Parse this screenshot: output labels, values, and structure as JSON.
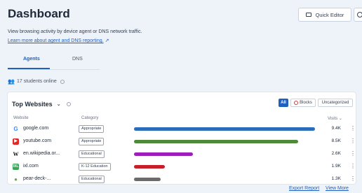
{
  "header": {
    "title": "Dashboard",
    "quick_editor_label": "Quick Editor"
  },
  "intro": {
    "description": "View browsing activity by device agent or DNS network traffic.",
    "learn_more": "Learn more about agent and DNS reporting."
  },
  "tabs": [
    {
      "label": "Agents",
      "active": true
    },
    {
      "label": "DNS",
      "active": false
    }
  ],
  "online_status": "17 students online",
  "card": {
    "scope_label": "Top Websites",
    "filters": [
      "All",
      "Blocks",
      "Uncategorized"
    ],
    "active_filter": "All",
    "columns": {
      "website": "Website",
      "category": "Category",
      "visits": "Visits"
    },
    "rows": [
      {
        "site": "google.com",
        "icon": "google-icon",
        "category": "Appropriate",
        "visits_label": "9.4K",
        "fraction": 0.95,
        "color": "#2a6db8"
      },
      {
        "site": "youtube.com",
        "icon": "youtube-icon",
        "category": "Appropriate",
        "visits_label": "8.5K",
        "fraction": 0.86,
        "color": "#4e8a3a"
      },
      {
        "site": "en.wikipedia.or...",
        "icon": "wikipedia-icon",
        "category": "Educational",
        "visits_label": "2.6K",
        "fraction": 0.31,
        "color": "#9b1fb8"
      },
      {
        "site": "ixl.com",
        "icon": "ixl-icon",
        "category": "K-12 Education",
        "visits_label": "1.9K",
        "fraction": 0.16,
        "color": "#c81e2a"
      },
      {
        "site": "pear-deck-...",
        "icon": "peardeck-icon",
        "category": "Educational",
        "visits_label": "1.3K",
        "fraction": 0.14,
        "color": "#6b6b6b"
      }
    ],
    "export_label": "Export Report",
    "view_more_label": "View More"
  }
}
